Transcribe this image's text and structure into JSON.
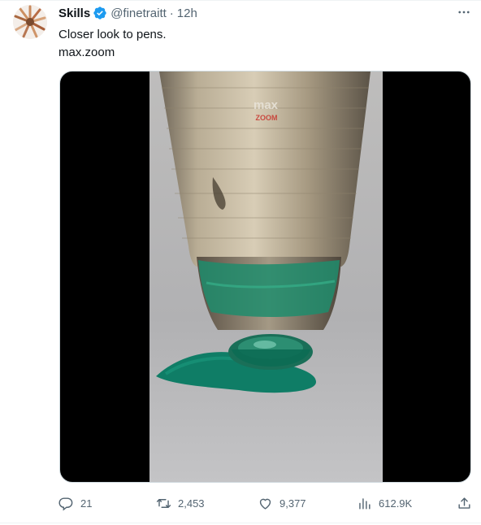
{
  "tweet": {
    "author_name": "Skills",
    "handle": "@finetraitt",
    "separator": "·",
    "time": "12h",
    "text_lines": [
      "Closer look to pens.",
      "max.zoom"
    ]
  },
  "media": {
    "watermark_top": "max",
    "watermark_bottom": "ZOOM",
    "ink_color": "#13826a"
  },
  "actions": {
    "replies": "21",
    "reposts": "2,453",
    "likes": "9,377",
    "views": "612.9K"
  },
  "colors": {
    "verified": "#1d9bf0",
    "secondary_text": "#536471"
  }
}
